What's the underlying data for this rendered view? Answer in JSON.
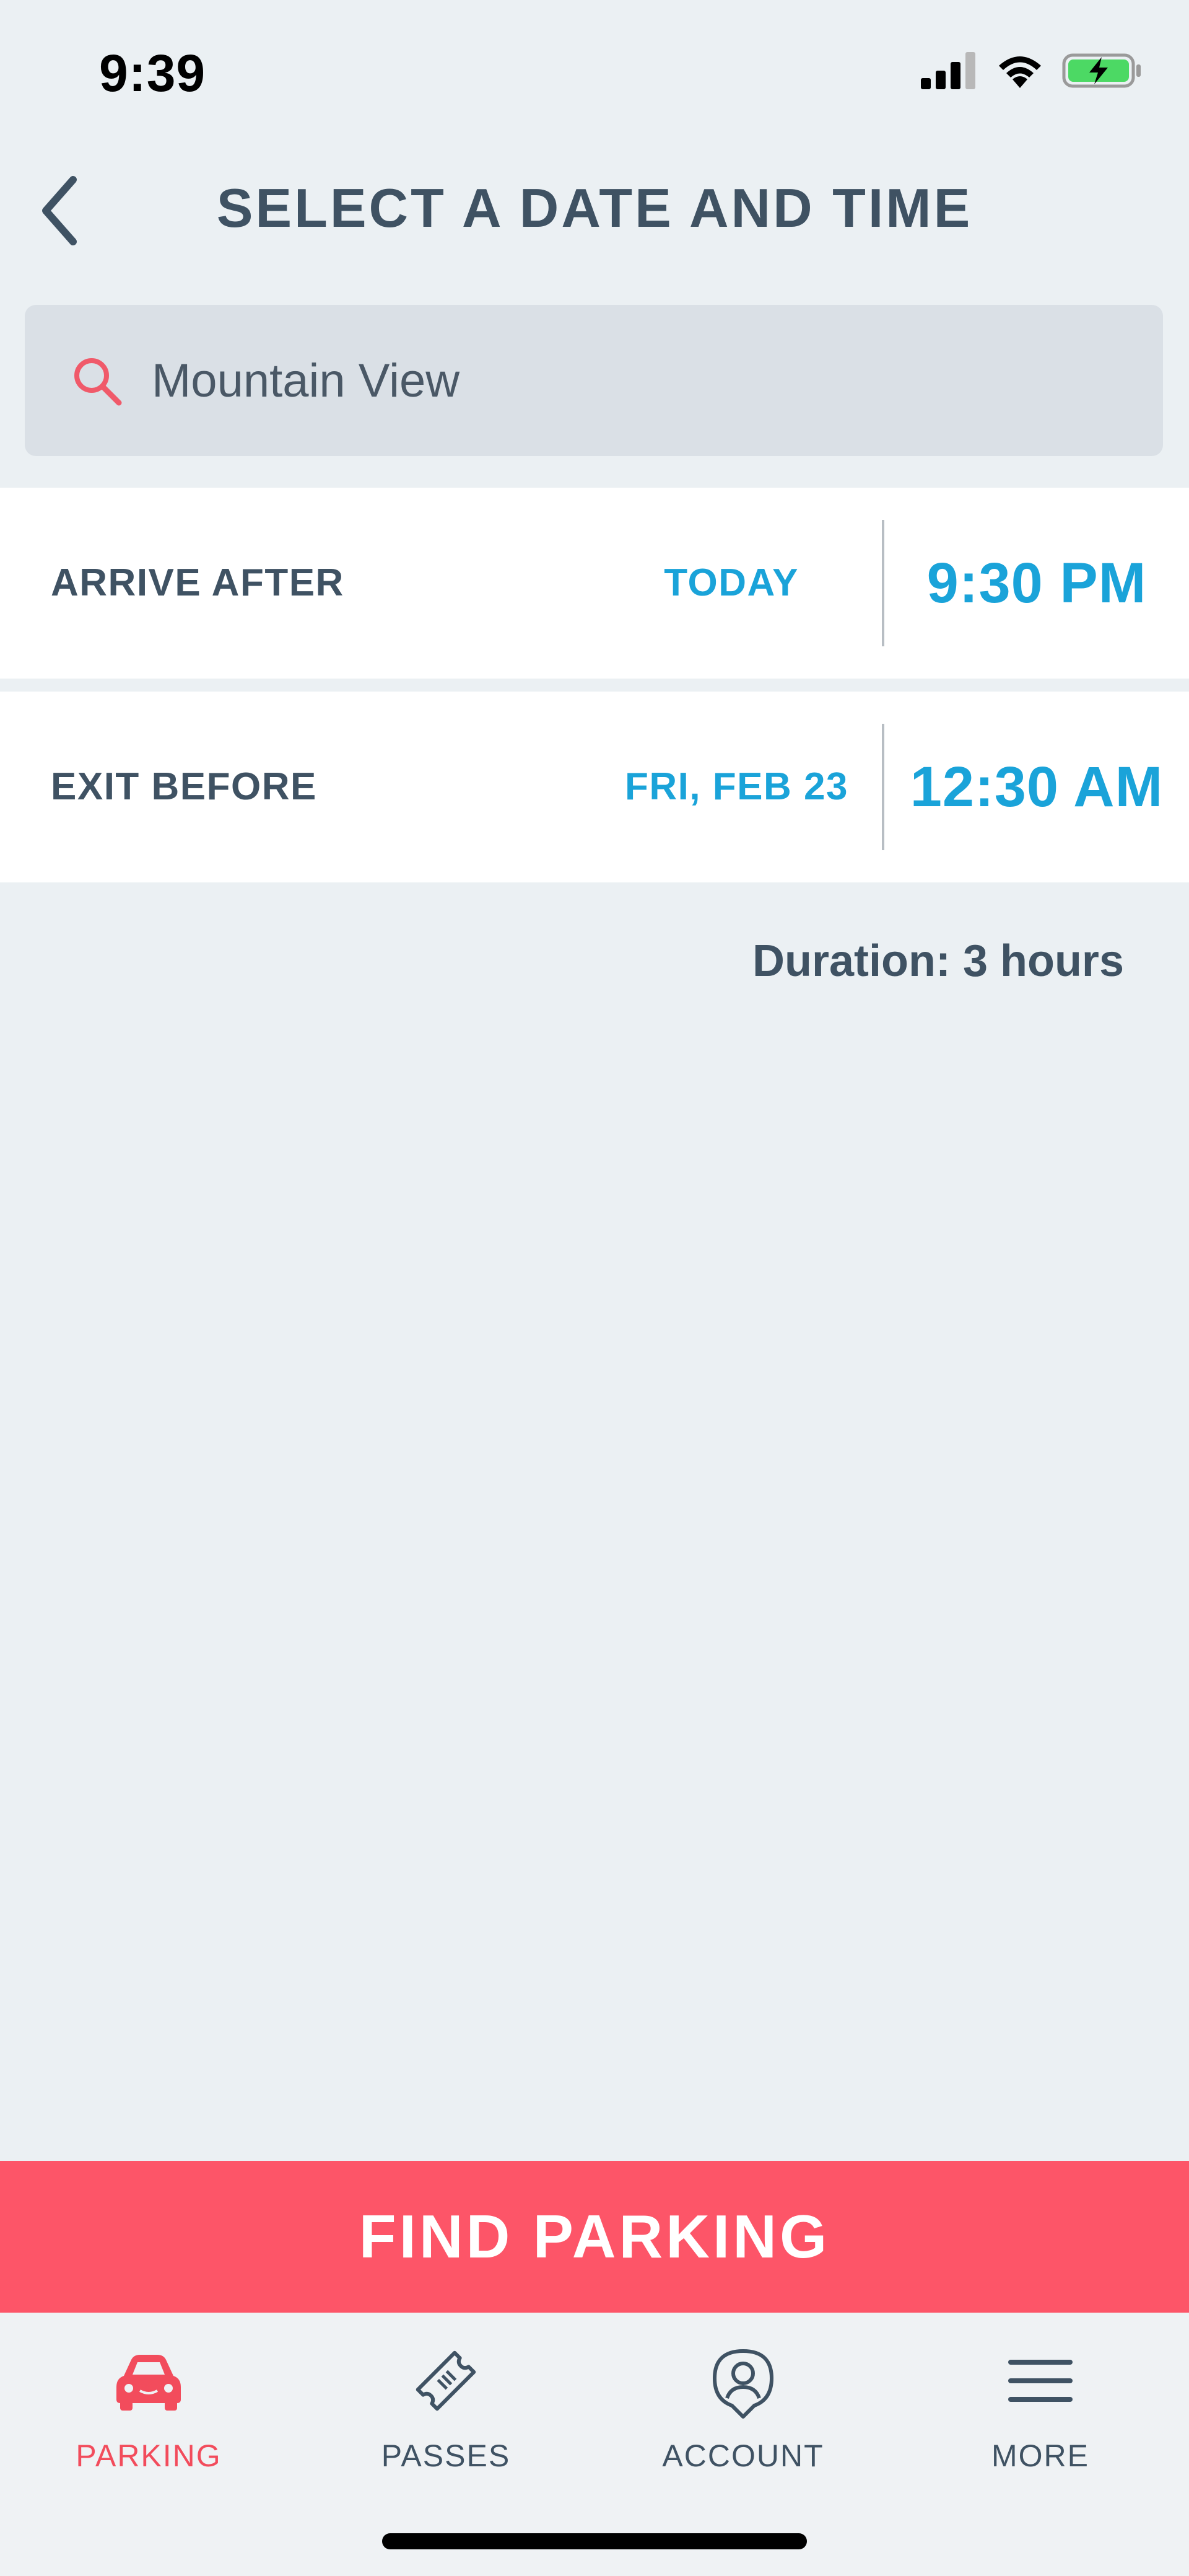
{
  "status_bar": {
    "time": "9:39"
  },
  "header": {
    "title": "SELECT A DATE AND TIME"
  },
  "search": {
    "value": "Mountain View",
    "placeholder": ""
  },
  "arrive": {
    "label": "ARRIVE AFTER",
    "date": "TODAY",
    "time": "9:30 PM"
  },
  "exit": {
    "label": "EXIT BEFORE",
    "date": "FRI, FEB 23",
    "time": "12:30 AM"
  },
  "duration": "Duration: 3 hours",
  "find_button": "FIND PARKING",
  "nav": {
    "items": [
      {
        "label": "PARKING",
        "icon": "car-icon",
        "active": true
      },
      {
        "label": "PASSES",
        "icon": "ticket-icon",
        "active": false
      },
      {
        "label": "ACCOUNT",
        "icon": "account-icon",
        "active": false
      },
      {
        "label": "MORE",
        "icon": "menu-icon",
        "active": false
      }
    ]
  },
  "colors": {
    "accent_blue": "#1aa3d9",
    "brand_red": "#fd5568",
    "text_dark": "#3f5263",
    "background": "#ebf0f3",
    "battery_green": "#4cd964"
  }
}
